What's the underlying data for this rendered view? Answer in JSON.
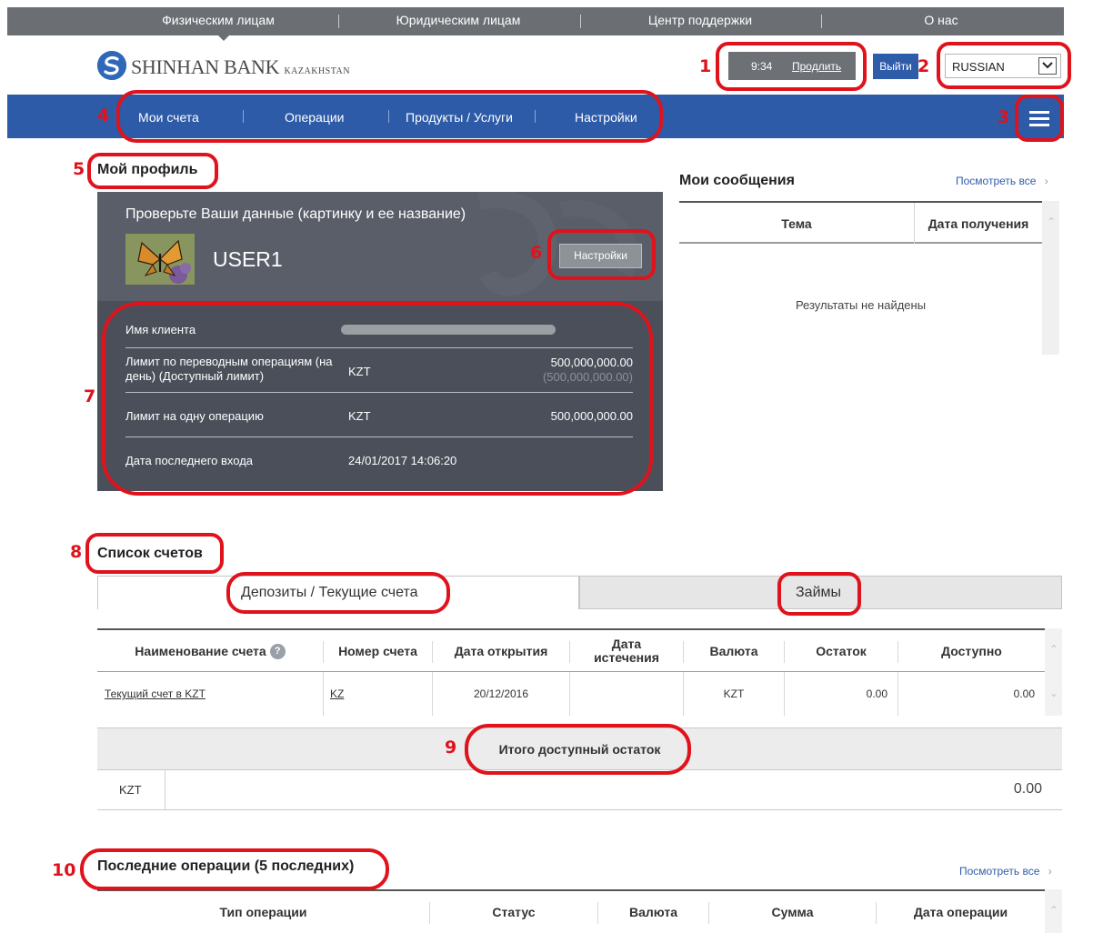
{
  "top_nav": [
    "Физическим лицам",
    "Юридическим лицам",
    "Центр поддержки",
    "О нас"
  ],
  "header": {
    "logo_main": "SHINHAN BANK",
    "logo_sub": "KAZAKHSTAN",
    "timer": "9:34",
    "extend": "Продлить",
    "logout": "Выйти",
    "language": "RUSSIAN"
  },
  "main_nav": [
    "Мои счета",
    "Операции",
    "Продукты / Услуги",
    "Настройки"
  ],
  "annotations": [
    "1",
    "2",
    "3",
    "4",
    "5",
    "6",
    "7",
    "8",
    "9",
    "10"
  ],
  "profile": {
    "title": "Мой профиль",
    "check_text": "Проверьте Ваши данные (картинку и ее название)",
    "username": "USER1",
    "settings_button": "Настройки",
    "client_name_label": "Имя клиента",
    "limit_day_label": "Лимит по переводным операциям (на день) (Доступный лимит)",
    "limit_day_currency": "KZT",
    "limit_day_value": "500,000,000.00",
    "limit_day_available": "(500,000,000.00)",
    "limit_op_label": "Лимит на одну операцию",
    "limit_op_currency": "KZT",
    "limit_op_value": "500,000,000.00",
    "last_login_label": "Дата последнего входа",
    "last_login_value": "24/01/2017 14:06:20"
  },
  "messages": {
    "title": "Мои сообщения",
    "view_all": "Посмотреть все",
    "columns": [
      "Тема",
      "Дата получения"
    ],
    "empty": "Результаты не найдены"
  },
  "accounts": {
    "title": "Список счетов",
    "tabs": [
      "Депозиты / Текущие счета",
      "Займы"
    ],
    "columns": [
      "Наименование счета",
      "Номер счета",
      "Дата открытия",
      "Дата истечения",
      "Валюта",
      "Остаток",
      "Доступно"
    ],
    "help_icon": "?",
    "rows": [
      {
        "name": "Текущий счет в KZT",
        "number": "KZ",
        "opened": "20/12/2016",
        "expires": "",
        "currency": "KZT",
        "balance": "0.00",
        "available": "0.00"
      }
    ],
    "total_label": "Итого доступный остаток",
    "total_currency": "KZT",
    "total_value": "0.00"
  },
  "recent_ops": {
    "title": "Последние операции (5 последних)",
    "view_all": "Посмотреть все",
    "columns": [
      "Тип операции",
      "Статус",
      "Валюта",
      "Сумма",
      "Дата операции"
    ]
  },
  "colors": {
    "annotation": "#e0121b",
    "nav_blue": "#2d5ba7",
    "top_gray": "#6b6e73",
    "card": "#4a4f5a"
  }
}
